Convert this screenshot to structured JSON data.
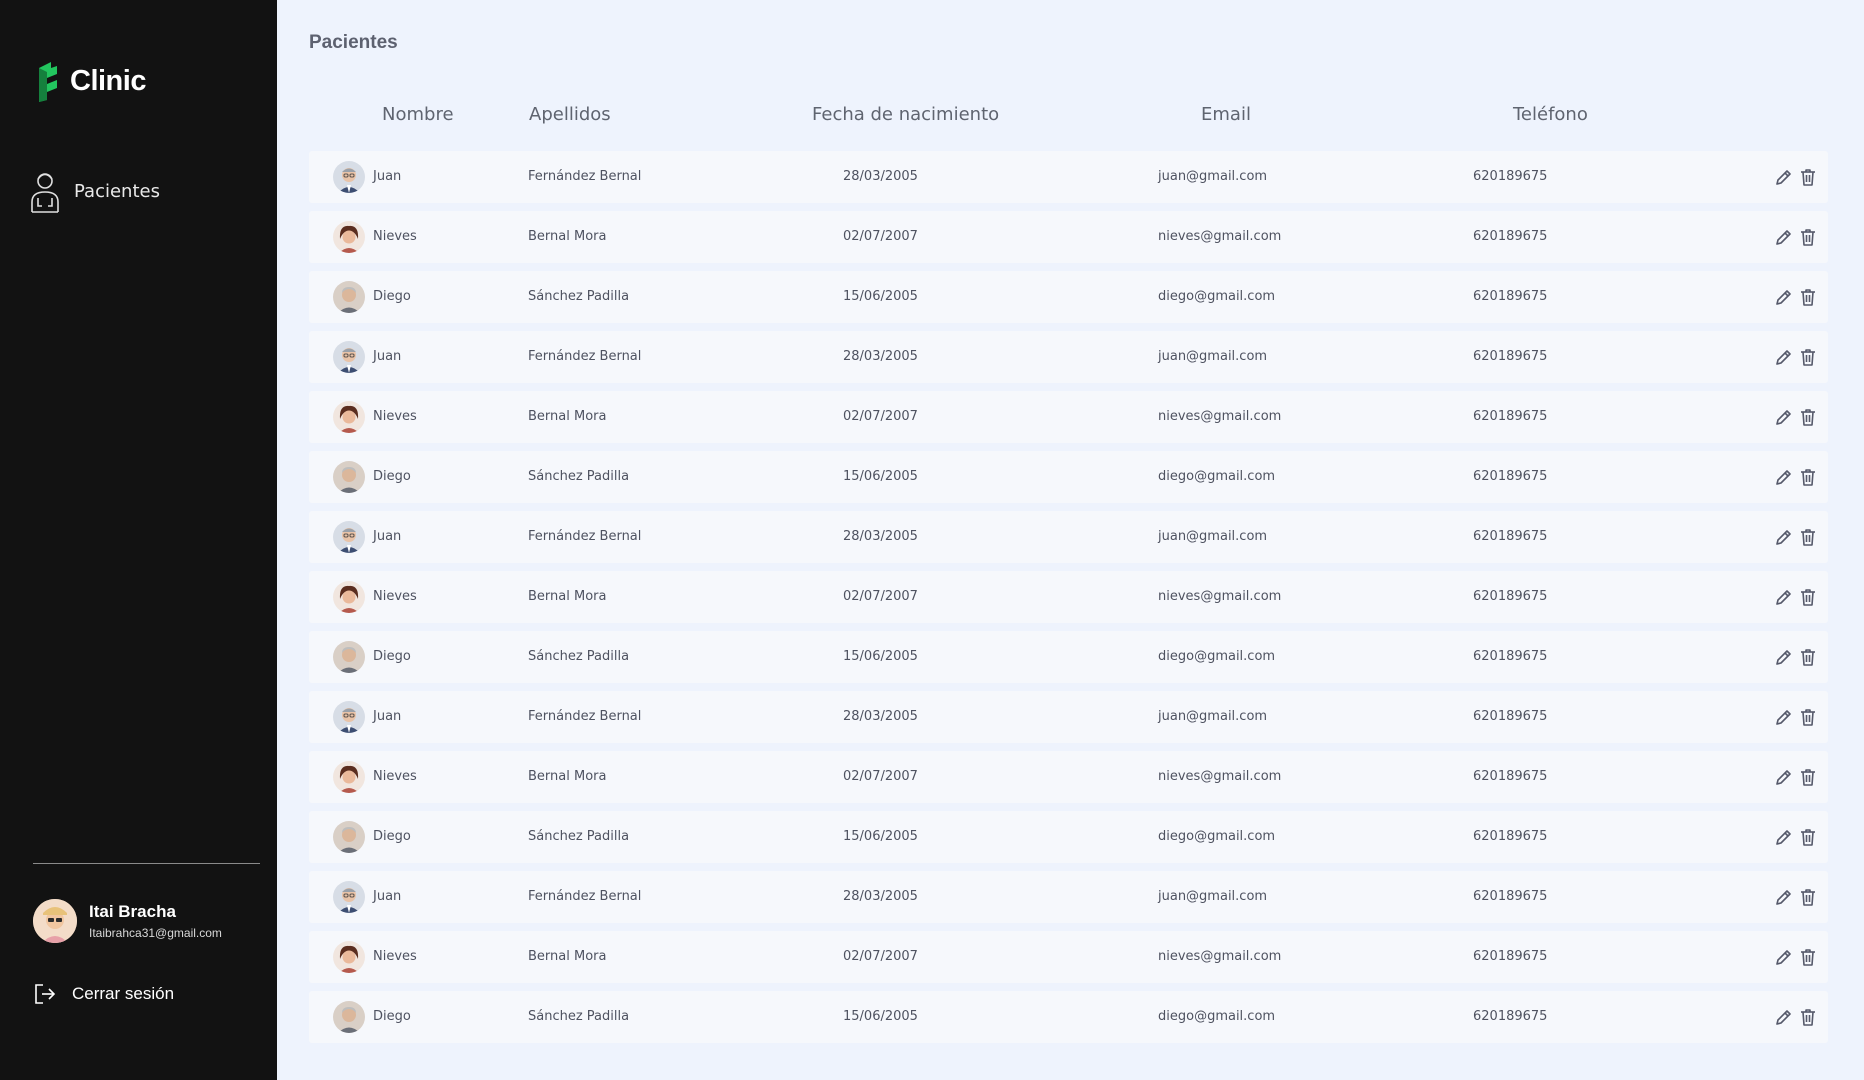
{
  "app": {
    "name": "Clinic",
    "accent": "#22c55e"
  },
  "sidebar": {
    "items": [
      {
        "label": "Pacientes",
        "icon": "patient-icon"
      }
    ]
  },
  "user": {
    "name": "Itai Bracha",
    "email": "Itaibrahca31@gmail.com"
  },
  "logout": {
    "label": "Cerrar sesión",
    "icon": "logout-icon"
  },
  "page": {
    "title": "Pacientes"
  },
  "table": {
    "headers": [
      "Nombre",
      "Apellidos",
      "Fecha de nacimiento",
      "Email",
      "Teléfono"
    ],
    "rows": [
      {
        "avatar": "man-glasses",
        "nombre": "Juan",
        "apellidos": "Fernández Bernal",
        "fecha": "28/03/2005",
        "email": "juan@gmail.com",
        "telefono": "620189675"
      },
      {
        "avatar": "woman",
        "nombre": "Nieves",
        "apellidos": "Bernal Mora",
        "fecha": "02/07/2007",
        "email": "nieves@gmail.com",
        "telefono": "620189675"
      },
      {
        "avatar": "old-man",
        "nombre": "Diego",
        "apellidos": "Sánchez Padilla",
        "fecha": "15/06/2005",
        "email": "diego@gmail.com",
        "telefono": "620189675"
      },
      {
        "avatar": "man-glasses",
        "nombre": "Juan",
        "apellidos": "Fernández Bernal",
        "fecha": "28/03/2005",
        "email": "juan@gmail.com",
        "telefono": "620189675"
      },
      {
        "avatar": "woman",
        "nombre": "Nieves",
        "apellidos": "Bernal Mora",
        "fecha": "02/07/2007",
        "email": "nieves@gmail.com",
        "telefono": "620189675"
      },
      {
        "avatar": "old-man",
        "nombre": "Diego",
        "apellidos": "Sánchez Padilla",
        "fecha": "15/06/2005",
        "email": "diego@gmail.com",
        "telefono": "620189675"
      },
      {
        "avatar": "man-glasses",
        "nombre": "Juan",
        "apellidos": "Fernández Bernal",
        "fecha": "28/03/2005",
        "email": "juan@gmail.com",
        "telefono": "620189675"
      },
      {
        "avatar": "woman",
        "nombre": "Nieves",
        "apellidos": "Bernal Mora",
        "fecha": "02/07/2007",
        "email": "nieves@gmail.com",
        "telefono": "620189675"
      },
      {
        "avatar": "old-man",
        "nombre": "Diego",
        "apellidos": "Sánchez Padilla",
        "fecha": "15/06/2005",
        "email": "diego@gmail.com",
        "telefono": "620189675"
      },
      {
        "avatar": "man-glasses",
        "nombre": "Juan",
        "apellidos": "Fernández Bernal",
        "fecha": "28/03/2005",
        "email": "juan@gmail.com",
        "telefono": "620189675"
      },
      {
        "avatar": "woman",
        "nombre": "Nieves",
        "apellidos": "Bernal Mora",
        "fecha": "02/07/2007",
        "email": "nieves@gmail.com",
        "telefono": "620189675"
      },
      {
        "avatar": "old-man",
        "nombre": "Diego",
        "apellidos": "Sánchez Padilla",
        "fecha": "15/06/2005",
        "email": "diego@gmail.com",
        "telefono": "620189675"
      },
      {
        "avatar": "man-glasses",
        "nombre": "Juan",
        "apellidos": "Fernández Bernal",
        "fecha": "28/03/2005",
        "email": "juan@gmail.com",
        "telefono": "620189675"
      },
      {
        "avatar": "woman",
        "nombre": "Nieves",
        "apellidos": "Bernal Mora",
        "fecha": "02/07/2007",
        "email": "nieves@gmail.com",
        "telefono": "620189675"
      },
      {
        "avatar": "old-man",
        "nombre": "Diego",
        "apellidos": "Sánchez Padilla",
        "fecha": "15/06/2005",
        "email": "diego@gmail.com",
        "telefono": "620189675"
      }
    ],
    "row_actions": [
      "edit-icon",
      "delete-icon"
    ]
  }
}
